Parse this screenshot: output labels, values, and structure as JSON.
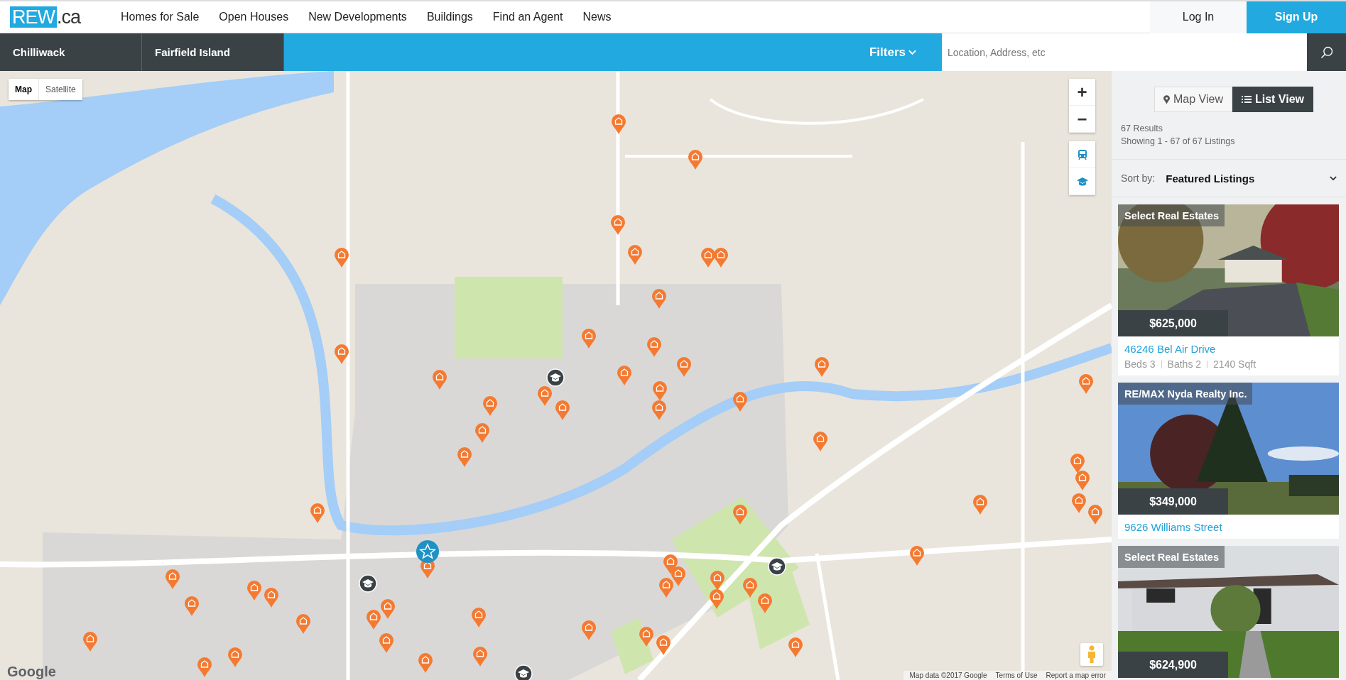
{
  "header": {
    "logo": {
      "main": "REW",
      "suffix": ".ca"
    },
    "nav": [
      "Homes for Sale",
      "Open Houses",
      "New Developments",
      "Buildings",
      "Find an Agent",
      "News"
    ],
    "login": "Log In",
    "signup": "Sign Up"
  },
  "search_bar": {
    "breadcrumbs": [
      "Chilliwack",
      "Fairfield Island"
    ],
    "filters": "Filters",
    "search": {
      "placeholder": "Location, Address, etc"
    }
  },
  "map": {
    "type_toggle": [
      {
        "label": "Map",
        "selected": true
      },
      {
        "label": "Satellite",
        "selected": false
      }
    ],
    "zoom_in": "+",
    "zoom_out": "−",
    "attribution": {
      "logo": "Google",
      "data": "Map data ©2017 Google",
      "terms": "Terms of Use",
      "report": "Report a map error"
    }
  },
  "results": {
    "views": [
      {
        "label": "Map View",
        "kind": "map",
        "selected": false
      },
      {
        "label": "List View",
        "kind": "list",
        "selected": true
      }
    ],
    "count": "67 Results",
    "showing": "Showing 1 - 67 of 67 Listings",
    "sort_label": "Sort by:",
    "sort_value": "Featured Listings"
  },
  "listings": [
    {
      "brokerage": "Select Real Estates",
      "price": "$625,000",
      "address": "46246 Bel Air Drive",
      "stats": [
        "Beds 3",
        "Baths 2",
        "2140 Sqft"
      ]
    },
    {
      "brokerage": "RE/MAX Nyda Realty Inc.",
      "price": "$349,000",
      "address": "9626 Williams Street"
    },
    {
      "brokerage": "Select Real Estates",
      "price": "$624,900"
    }
  ]
}
